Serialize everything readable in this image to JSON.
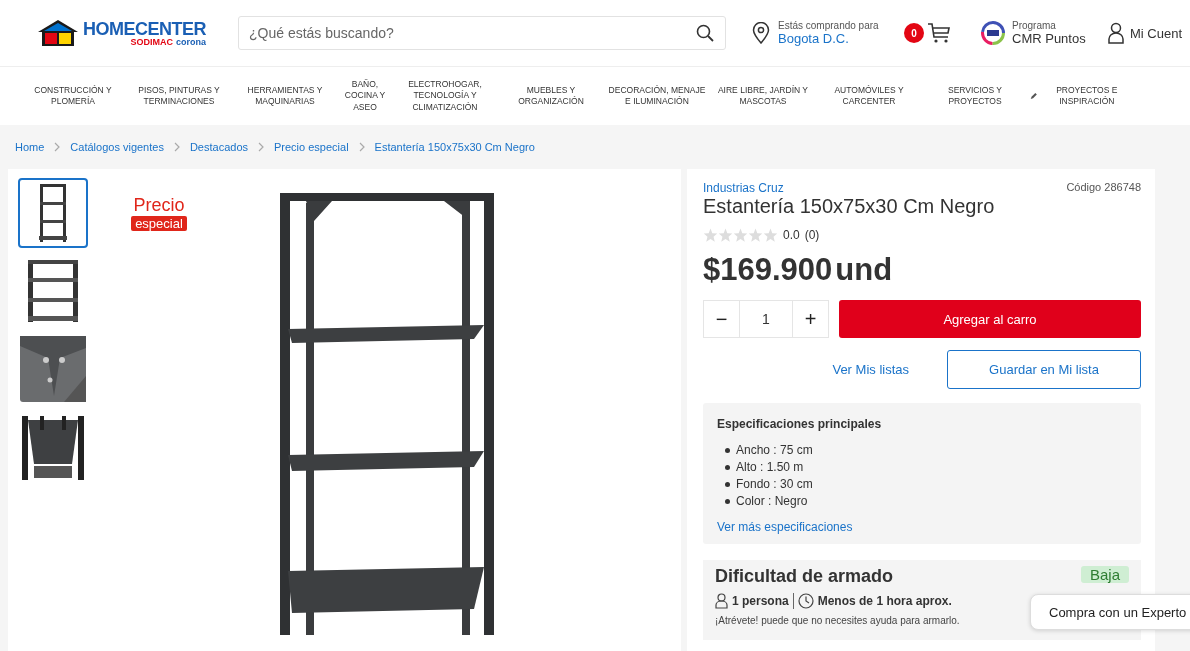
{
  "header": {
    "logo": {
      "brand": "HOMECENTER",
      "maker": "SODIMAC",
      "maker_2": "corona"
    },
    "search": {
      "placeholder": "¿Qué estás buscando?"
    },
    "location": {
      "label": "Estás comprando para",
      "city": "Bogota D.C."
    },
    "cart": {
      "count": "0"
    },
    "points": {
      "label": "Programa",
      "name": "CMR Puntos"
    },
    "account": {
      "label": "Mi Cuent"
    }
  },
  "nav": [
    {
      "label": "CONSTRUCCIÓN Y PLOMERÍA",
      "kind": "plain"
    },
    {
      "label": "PISOS, PINTURAS Y TERMINACIONES",
      "kind": "plain"
    },
    {
      "label": "HERRAMIENTAS Y MAQUINARIAS",
      "kind": "plain"
    },
    {
      "label": "BAÑO, COCINA Y ASEO",
      "kind": "narrow"
    },
    {
      "label": "ELECTROHOGAR, TECNOLOGÍA Y CLIMATIZACIÓN",
      "kind": "plain"
    },
    {
      "label": "MUEBLES Y ORGANIZACIÓN",
      "kind": "plain"
    },
    {
      "label": "DECORACIÓN, MENAJE E ILUMINACIÓN",
      "kind": "plain"
    },
    {
      "label": "AIRE LIBRE, JARDÍN Y MASCOTAS",
      "kind": "plain"
    },
    {
      "label": "AUTOMÓVILES Y CARCENTER",
      "kind": "plain"
    },
    {
      "label": "SERVICIOS Y PROYECTOS",
      "kind": "plain"
    },
    {
      "label": "PROYECTOS E INSPIRACIÓN",
      "kind": "pencil"
    }
  ],
  "breadcrumb": [
    "Home",
    "Catálogos vigentes",
    "Destacados",
    "Precio especial",
    "Estantería 150x75x30 Cm Negro"
  ],
  "gallery": {
    "thumbnails": [
      {
        "kind": "picture",
        "selected": true
      },
      {
        "kind": "picture",
        "selected": false
      },
      {
        "kind": "picture",
        "selected": false
      },
      {
        "kind": "picture",
        "selected": false
      }
    ],
    "badge": {
      "line_1": "Precio",
      "line_2": "especial"
    },
    "main": {
      "kind": "picture"
    }
  },
  "product": {
    "brand": "Industrias Cruz",
    "code": "Código 286748",
    "title": "Estantería 150x75x30 Cm Negro",
    "stars": 0,
    "rating": "0.0",
    "reviews": "(0)",
    "price": "$169.900",
    "unit": "und",
    "quantity": "1",
    "minus": "−",
    "plus": "+",
    "add_button": "Agregar al carro",
    "lists_link": "Ver Mis listas",
    "save_button": "Guardar en Mi lista"
  },
  "specs": {
    "title": "Especificaciones principales",
    "items": [
      "Ancho : 75 cm",
      "Alto : 1.50 m",
      "Fondo : 30 cm",
      "Color : Negro"
    ],
    "more": "Ver más especificaciones"
  },
  "assembly": {
    "title": "Dificultad de armado",
    "level": "Baja",
    "people": "1 persona",
    "time": "Menos de 1 hora aprox.",
    "note": "¡Atrévete! puede que no necesites ayuda para armarlo."
  },
  "expert_chip": "Compra con un Experto"
}
